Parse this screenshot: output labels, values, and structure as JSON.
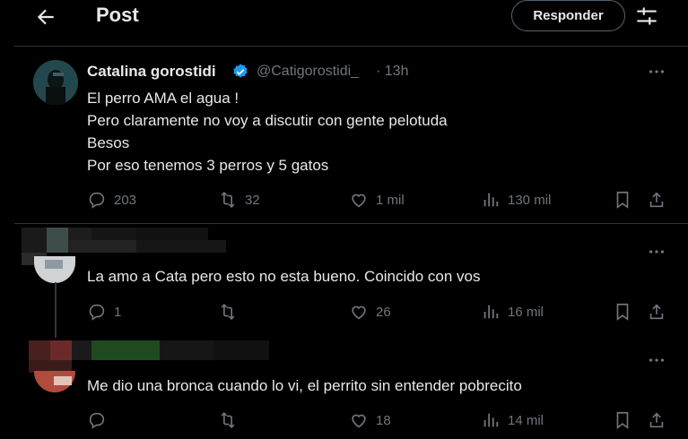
{
  "header": {
    "title": "Post",
    "respond_label": "Responder"
  },
  "main_post": {
    "name": "Catalina gorostidi",
    "handle": "@Catigorostidi_",
    "time": "· 13h",
    "lines": [
      "El perro AMA el agua !",
      "Pero claramente no voy a discutir con gente pelotuda",
      "Besos",
      "Por eso tenemos 3 perros y 5 gatos"
    ],
    "replies": "203",
    "reposts": "32",
    "likes": "1 mil",
    "views": "130 mil"
  },
  "replies": [
    {
      "text": "La amo a Cata pero esto no esta bueno. Coincido con vos",
      "replies": "1",
      "reposts": "",
      "likes": "26",
      "views": "16 mil"
    },
    {
      "text": "Me dio una bronca cuando lo vi, el perrito sin entender pobrecito",
      "replies": "",
      "reposts": "",
      "likes": "18",
      "views": "14 mil"
    }
  ],
  "colors": {
    "background": "#000000",
    "text": "#e7e9ea",
    "muted": "#71767b",
    "verified": "#1d9bf0",
    "divider": "#2f3336"
  },
  "icons": [
    "back-arrow-icon",
    "tune-icon",
    "verified-badge-icon",
    "more-icon",
    "reply-icon",
    "repost-icon",
    "like-icon",
    "views-icon",
    "bookmark-icon",
    "share-icon"
  ]
}
